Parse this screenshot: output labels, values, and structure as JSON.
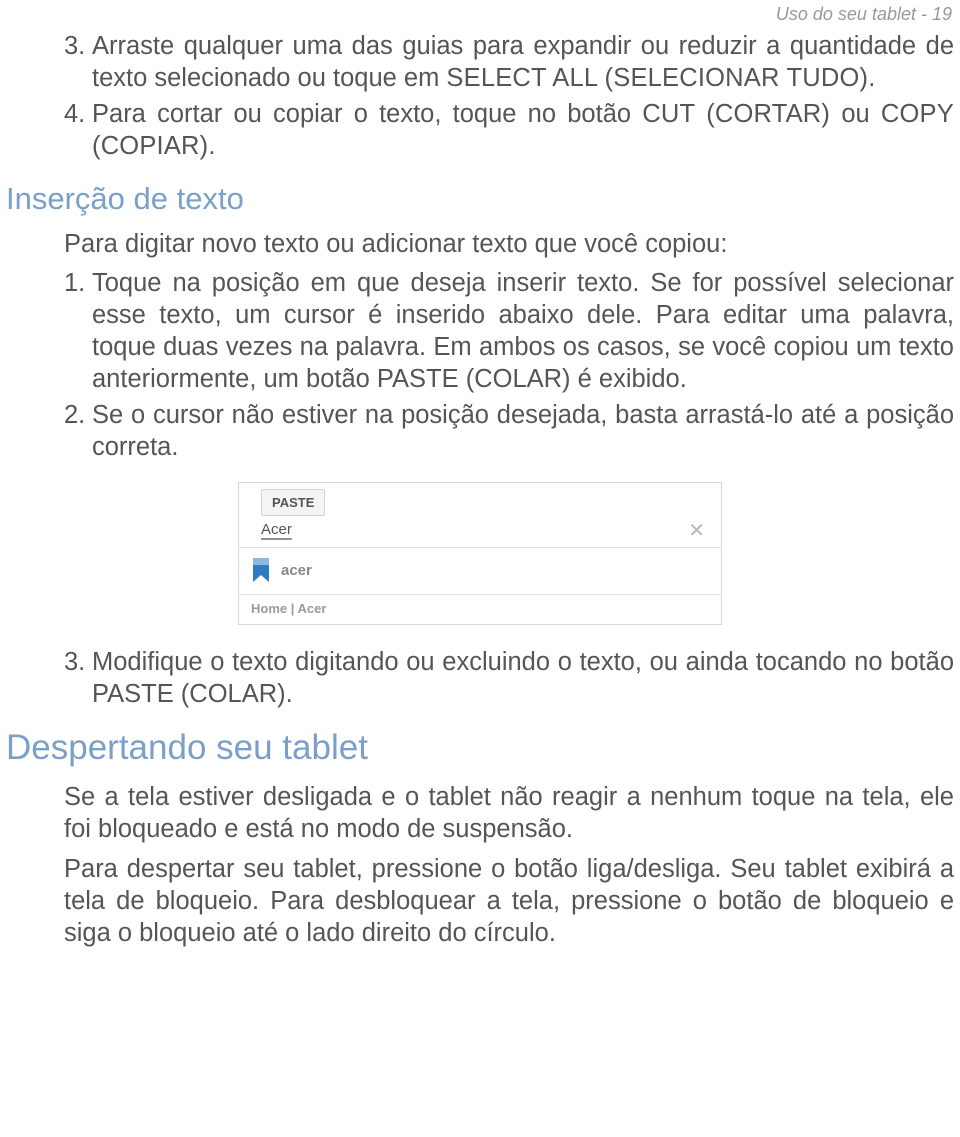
{
  "header": {
    "text": "Uso do seu tablet - 19"
  },
  "section1": {
    "items": [
      {
        "num": "3.",
        "text_a": "Arraste qualquer uma das guias para expandir ou reduzir a quantidade de texto selecionado ou toque em ",
        "bold": "SELECT ALL (SELECIONAR TUDO)",
        "text_b": "."
      },
      {
        "num": "4.",
        "text_a": "Para cortar ou copiar o texto, toque no botão ",
        "bold1": "CUT (CORTAR)",
        "mid": " ou ",
        "bold2": "COPY (COPIAR)",
        "text_b": "."
      }
    ]
  },
  "h2": "Inserção de texto",
  "para_intro": "Para digitar novo texto ou adicionar texto que você copiou:",
  "section2": {
    "items": [
      {
        "num": "1.",
        "text": "Toque na posição em que deseja inserir texto. Se for possível selecionar esse texto, um cursor é inserido abaixo dele. Para editar uma palavra, toque duas vezes na palavra. Em ambos os casos, se você copiou um texto anteriormente, um botão PASTE (COLAR) é exibido."
      },
      {
        "num": "2.",
        "text": "Se o cursor não estiver na posição desejada, basta arrastá-lo até a posição correta."
      }
    ]
  },
  "figure": {
    "tooltip": "PASTE",
    "input_value": "Acer",
    "close_label": "✕",
    "bookmark_title": "acer",
    "breadcrumb": "Home | Acer"
  },
  "section3": {
    "items": [
      {
        "num": "3.",
        "text": "Modifique o texto digitando ou excluindo o texto, ou ainda tocando no botão PASTE (COLAR)."
      }
    ]
  },
  "h1": "Despertando seu tablet",
  "para_wake1": "Se a tela estiver desligada e o tablet não reagir a nenhum toque na tela, ele foi bloqueado e está no modo de suspensão.",
  "para_wake2": "Para despertar seu tablet, pressione o botão liga/desliga. Seu tablet exibirá a tela de bloqueio. Para desbloquear a tela, pressione o botão de bloqueio e siga o bloqueio até o lado direito do círculo."
}
